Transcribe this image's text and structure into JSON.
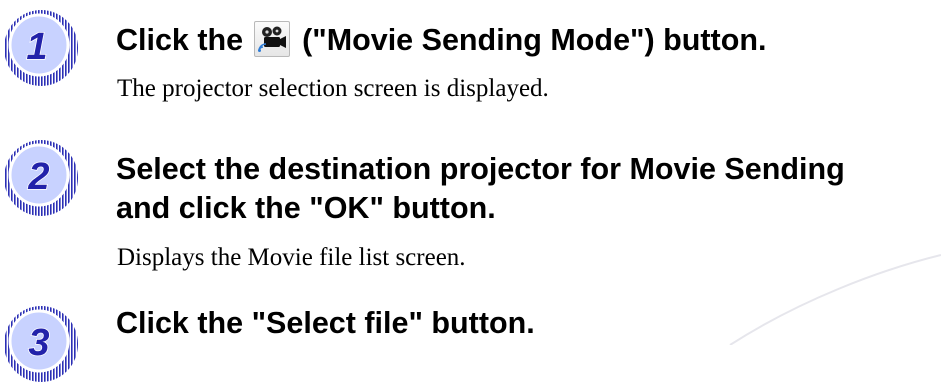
{
  "steps": [
    {
      "number": "1",
      "title_before": "Click the",
      "icon": "movie-camera-icon",
      "title_after": "(\"Movie Sending Mode\") button.",
      "description": "The projector selection screen is displayed."
    },
    {
      "number": "2",
      "title_line1": "Select the destination projector for Movie Sending",
      "title_line2": "and click the \"OK\" button.",
      "description": "Displays the Movie file list screen."
    },
    {
      "number": "3",
      "title": "Click the \"Select file\" button."
    }
  ],
  "colors": {
    "badge_fill": "#c8d2ff",
    "badge_number": "#2222aa",
    "text": "#000000"
  }
}
